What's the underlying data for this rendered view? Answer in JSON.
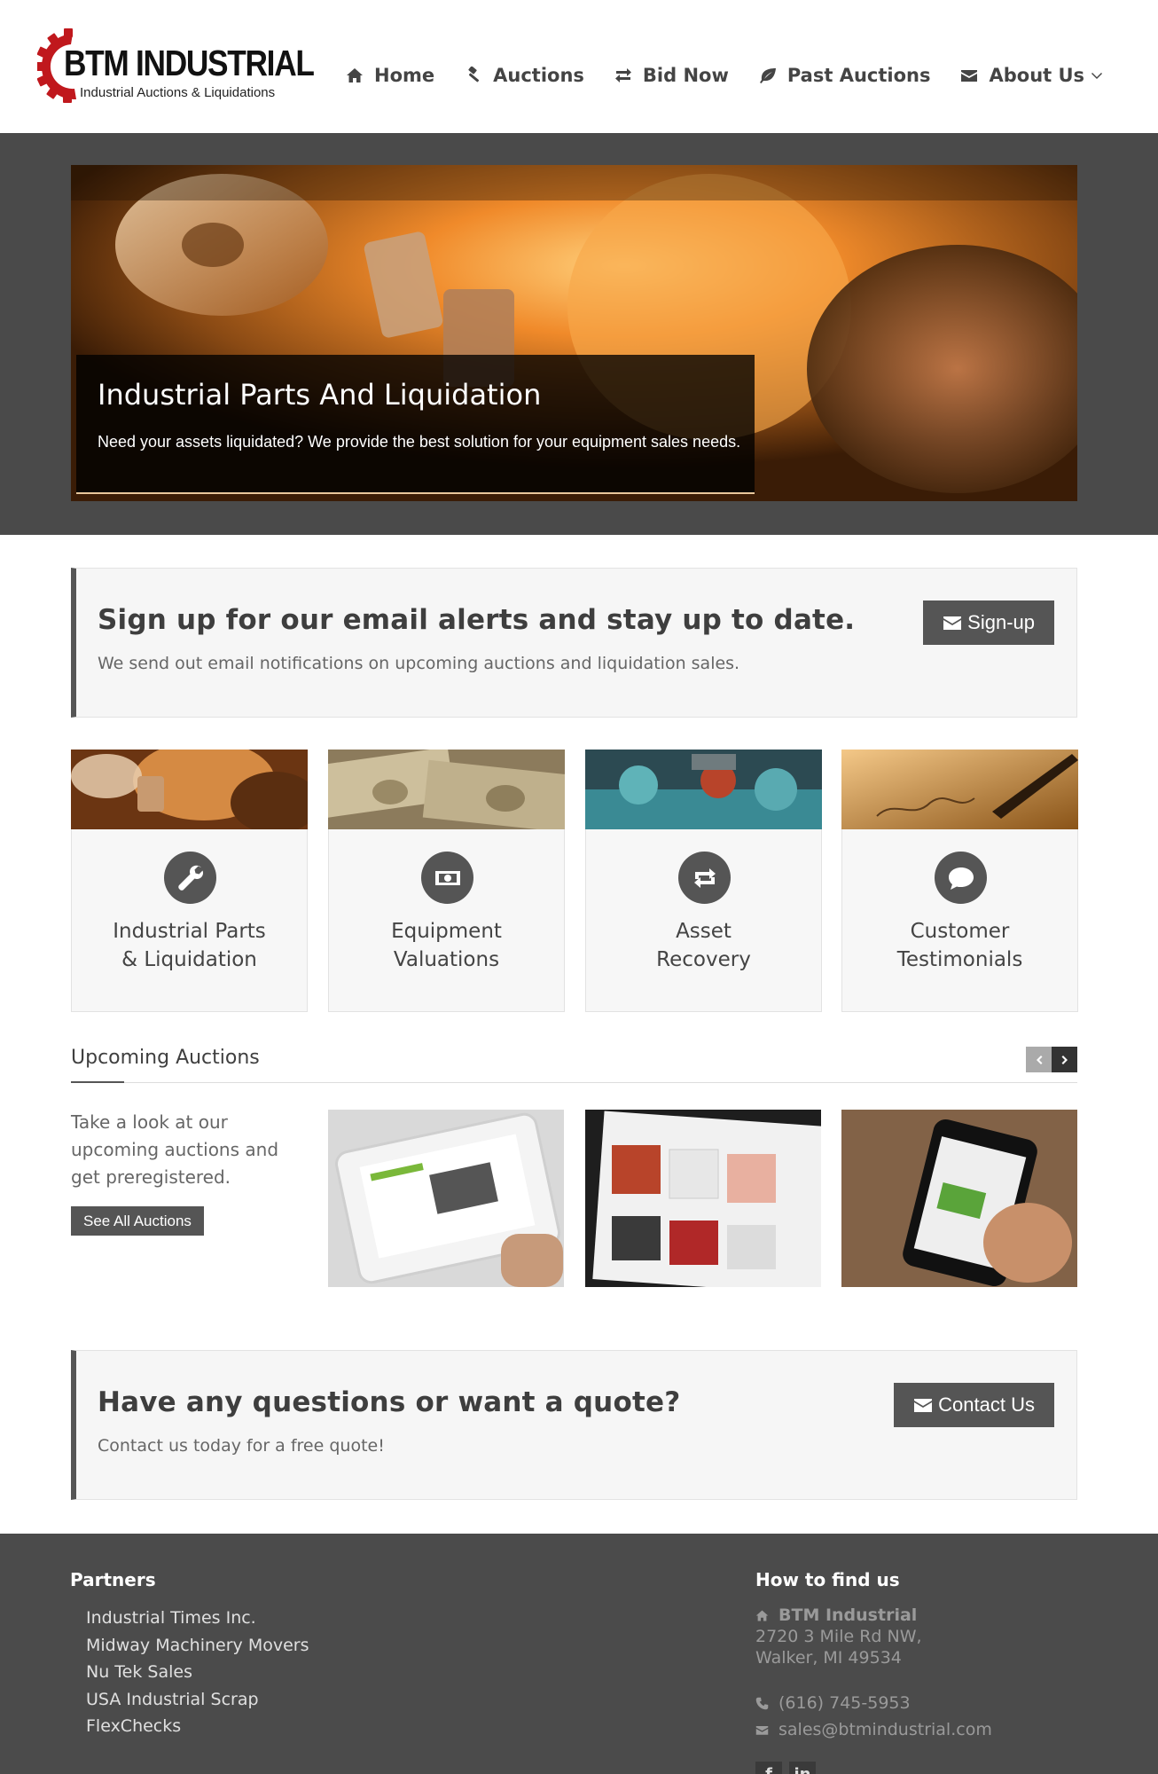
{
  "brand": {
    "name": "BTM INDUSTRIAL",
    "tagline": "Industrial Auctions & Liquidations"
  },
  "nav": [
    {
      "label": "Home",
      "icon": "home-icon"
    },
    {
      "label": "Auctions",
      "icon": "gavel-icon"
    },
    {
      "label": "Bid Now",
      "icon": "exchange-icon"
    },
    {
      "label": "Past Auctions",
      "icon": "leaf-icon"
    },
    {
      "label": "About Us",
      "icon": "envelope-icon",
      "dropdown": true
    }
  ],
  "hero": {
    "title": "Industrial Parts And Liquidation",
    "subtitle": "Need your assets liquidated? We provide the best solution for your equipment sales needs."
  },
  "signup": {
    "title": "Sign up for our email alerts and stay up to date.",
    "text": "We send out email notifications on upcoming auctions and liquidation sales.",
    "button": "Sign-up"
  },
  "features": [
    {
      "label": "Industrial Parts\n& Liquidation",
      "icon": "wrench-icon"
    },
    {
      "label": "Equipment\nValuations",
      "icon": "money-icon"
    },
    {
      "label": "Asset\nRecovery",
      "icon": "retweet-icon"
    },
    {
      "label": "Customer\nTestimonials",
      "icon": "comment-icon"
    }
  ],
  "upcoming": {
    "title": "Upcoming Auctions",
    "text": "Take a look at our upcoming auctions and get preregistered.",
    "button": "See All Auctions"
  },
  "quote": {
    "title": "Have any questions or want a quote?",
    "text": "Contact us today for a free quote!",
    "button": "Contact Us"
  },
  "footer": {
    "partners_title": "Partners",
    "partners": [
      "Industrial Times Inc.",
      "Midway Machinery Movers",
      "Nu Tek Sales",
      "USA Industrial Scrap",
      "FlexChecks"
    ],
    "find_title": "How to find us",
    "company": "BTM Industrial",
    "address_line1": "2720 3 Mile Rd NW,",
    "address_line2": "Walker, MI 49534",
    "phone": "(616) 745-5953",
    "email": "sales@btmindustrial.com",
    "social": [
      "f",
      "in"
    ]
  },
  "colors": {
    "dark_band": "#4a4a4a",
    "button": "#555555",
    "logo_red": "#c0181d",
    "footer": "#4b4b4b"
  }
}
